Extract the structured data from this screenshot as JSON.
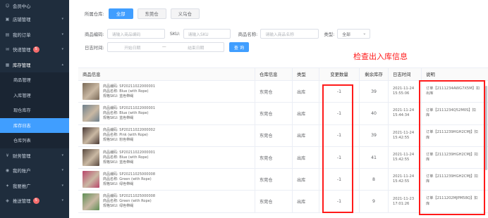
{
  "sidebar": {
    "items": [
      {
        "label": "会员中心",
        "icon": "user-icon"
      },
      {
        "label": "店铺管理",
        "icon": "shop-icon"
      },
      {
        "label": "我的订单",
        "icon": "order-icon"
      },
      {
        "label": "快递管理",
        "icon": "express-icon",
        "badge": "5"
      },
      {
        "label": "库存管理",
        "icon": "inventory-icon",
        "open": true
      },
      {
        "label": "财务管理",
        "icon": "finance-icon"
      },
      {
        "label": "我的账户",
        "icon": "account-icon"
      },
      {
        "label": "我要推广",
        "icon": "promote-icon"
      },
      {
        "label": "推送管理",
        "icon": "push-icon",
        "badge": "5"
      }
    ],
    "sub_items": [
      {
        "label": "商品管理"
      },
      {
        "label": "入库管理"
      },
      {
        "label": "现仓库存"
      },
      {
        "label": "库存日志",
        "active": true
      },
      {
        "label": "仓库列表"
      }
    ]
  },
  "filters": {
    "warehouse_label": "所属仓库:",
    "warehouses": [
      "全部",
      "东莞仓",
      "义乌仓"
    ],
    "sku_code_label": "商品编码:",
    "sku_code_placeholder": "请输入商品编码",
    "sku_label": "SKU:",
    "sku_placeholder": "请输入SKU",
    "name_label": "商品名称:",
    "name_placeholder": "请输入商品名称",
    "type_label": "类型:",
    "type_value": "全部",
    "date_label": "日志时间:",
    "start_placeholder": "开始日期",
    "range_sep": "—",
    "end_placeholder": "结束日期",
    "query_button": "查 询"
  },
  "annotation": "检查出入库信息",
  "table": {
    "headers": [
      "商品信息",
      "仓库信息",
      "类型",
      "变更数量",
      "剩余库存",
      "日志时间",
      "说明"
    ],
    "rows": [
      {
        "code": "商品编码: SP20211022000001",
        "name": "商品名称: Blue (with Rope)",
        "spec": "规格SKU: 蓝色带绳",
        "warehouse": "东莞仓",
        "type": "出库",
        "qty": "-1",
        "stock": "39",
        "date": "2021-11-24",
        "time": "15:55:06",
        "note1": "订单【2111234AWG7X5M】扣",
        "note2": "出库",
        "thumb": "#7a6a58"
      },
      {
        "code": "商品编码: SP20211022000001",
        "name": "商品名称: Blue (with Rope)",
        "spec": "规格SKU: 蓝色带绳",
        "warehouse": "东莞仓",
        "type": "出库",
        "qty": "-1",
        "stock": "40",
        "date": "2021-11-24",
        "time": "15:44:34",
        "note1": "订单【2111234Q52M0S】扣",
        "note2": "库",
        "thumb": "#6d7f8c"
      },
      {
        "code": "商品编码: SP20211022000002",
        "name": "商品名称: Pink (with Rope)",
        "spec": "规格SKU: 粉色带绳",
        "warehouse": "东莞仓",
        "type": "出库",
        "qty": "-1",
        "stock": "39",
        "date": "2021-11-24",
        "time": "15:42:55",
        "note1": "订单【2111239HGH2CMJ】扣",
        "note2": "库",
        "thumb": "#4a3a36"
      },
      {
        "code": "商品编码: SP20211022000001",
        "name": "商品名称: Blue (with Rope)",
        "spec": "规格SKU: 蓝色带绳",
        "warehouse": "东莞仓",
        "type": "出库",
        "qty": "-1",
        "stock": "41",
        "date": "2021-11-24",
        "time": "15:42:55",
        "note1": "订单【2111239HGH2CMJ】扣",
        "note2": "库",
        "thumb": "#5a4a40"
      },
      {
        "code": "商品编码: SP20211025000008",
        "name": "商品名称: Green (with Rope)",
        "spec": "规格SKU: 绿色带绳",
        "warehouse": "东莞仓",
        "type": "出库",
        "qty": "-1",
        "stock": "8",
        "date": "2021-11-24",
        "time": "15:42:55",
        "note1": "订单【2111239HGH2CMJ】扣",
        "note2": "库",
        "thumb": "#b9466a"
      },
      {
        "code": "商品编码: SP20211025000008",
        "name": "商品名称: Green (with Rope)",
        "spec": "规格SKU: 绿色带绳",
        "warehouse": "东莞仓",
        "type": "出库",
        "qty": "-1",
        "stock": "9",
        "date": "2021-11-23",
        "time": "17:01:26",
        "note1": "订单【2111202MJPM58Q】扣",
        "note2": "库",
        "thumb": "#5f8f55"
      }
    ]
  },
  "colors": {
    "accent": "#409eff",
    "sidebar": "#1f2d3d",
    "highlight": "#ff1a1a"
  }
}
